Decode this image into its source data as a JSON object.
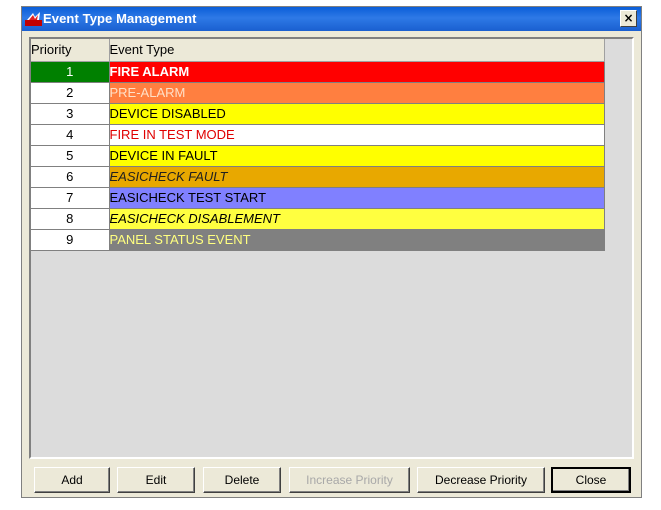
{
  "window": {
    "title": "Event Type Management",
    "close_glyph": "×"
  },
  "grid": {
    "columns": [
      "Priority",
      "Event Type"
    ],
    "rows": [
      {
        "priority": "1",
        "event_type": "FIRE ALARM",
        "bg": "#ff0000",
        "fg": "#ffffff",
        "priority_bg": "#008000",
        "priority_fg": "#ffffff",
        "bold": true,
        "italic": false
      },
      {
        "priority": "2",
        "event_type": "PRE-ALARM",
        "bg": "#ff7f40",
        "fg": "#ffe0c8",
        "priority_bg": "#ffffff",
        "priority_fg": "#000000",
        "bold": false,
        "italic": false
      },
      {
        "priority": "3",
        "event_type": "DEVICE DISABLED",
        "bg": "#ffff00",
        "fg": "#000000",
        "priority_bg": "#ffffff",
        "priority_fg": "#000000",
        "bold": false,
        "italic": false
      },
      {
        "priority": "4",
        "event_type": "FIRE IN TEST MODE",
        "bg": "#ffffff",
        "fg": "#e00000",
        "priority_bg": "#ffffff",
        "priority_fg": "#000000",
        "bold": false,
        "italic": false
      },
      {
        "priority": "5",
        "event_type": "DEVICE IN FAULT",
        "bg": "#ffff00",
        "fg": "#000000",
        "priority_bg": "#ffffff",
        "priority_fg": "#000000",
        "bold": false,
        "italic": false
      },
      {
        "priority": "6",
        "event_type": "EASICHECK FAULT",
        "bg": "#e8a800",
        "fg": "#202020",
        "priority_bg": "#ffffff",
        "priority_fg": "#000000",
        "bold": false,
        "italic": true
      },
      {
        "priority": "7",
        "event_type": "EASICHECK TEST START",
        "bg": "#8080ff",
        "fg": "#000000",
        "priority_bg": "#ffffff",
        "priority_fg": "#000000",
        "bold": false,
        "italic": false
      },
      {
        "priority": "8",
        "event_type": "EASICHECK DISABLEMENT",
        "bg": "#ffff40",
        "fg": "#000000",
        "priority_bg": "#ffffff",
        "priority_fg": "#000000",
        "bold": false,
        "italic": true
      },
      {
        "priority": "9",
        "event_type": "PANEL STATUS EVENT",
        "bg": "#808080",
        "fg": "#ffff80",
        "priority_bg": "#ffffff",
        "priority_fg": "#000000",
        "bold": false,
        "italic": false
      }
    ]
  },
  "buttons": [
    {
      "name": "add-button",
      "label": "Add",
      "enabled": true,
      "default": false
    },
    {
      "name": "edit-button",
      "label": "Edit",
      "enabled": true,
      "default": false
    },
    {
      "name": "delete-button",
      "label": "Delete",
      "enabled": true,
      "default": false
    },
    {
      "name": "increase-priority-button",
      "label": "Increase Priority",
      "enabled": false,
      "default": false
    },
    {
      "name": "decrease-priority-button",
      "label": "Decrease Priority",
      "enabled": true,
      "default": false
    },
    {
      "name": "close-button",
      "label": "Close",
      "enabled": true,
      "default": true
    }
  ],
  "colors": {
    "titlebar": "#1a5fd0",
    "dialog_bg": "#ece9d8",
    "empty_grid_bg": "#dcdcdc"
  }
}
